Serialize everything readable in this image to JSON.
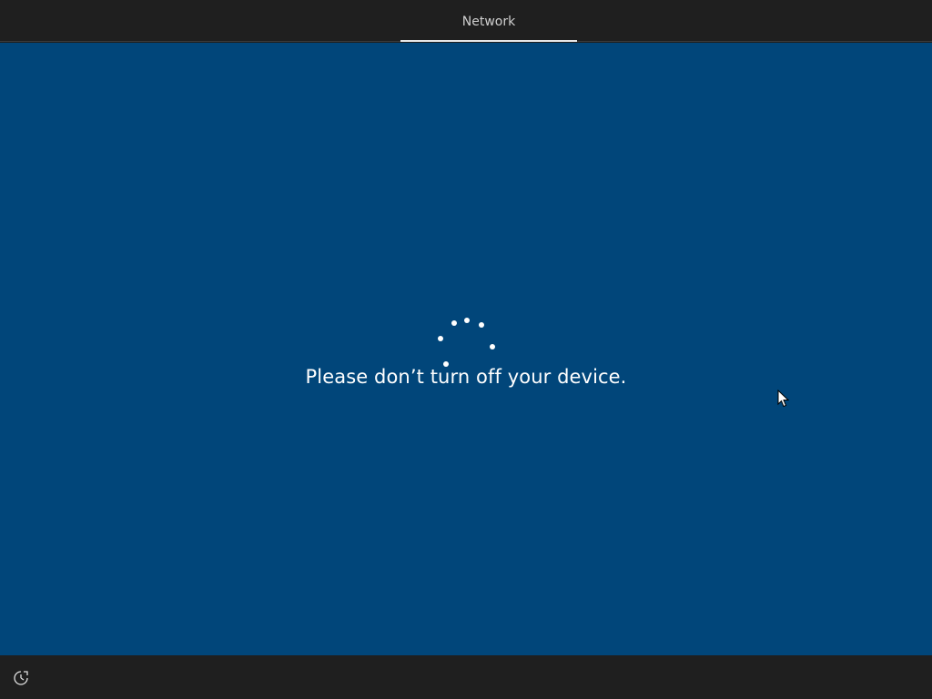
{
  "header": {
    "tab_label": "Network"
  },
  "main": {
    "message": "Please don’t turn off your device."
  },
  "footer": {
    "accessibility_icon": "ease-of-access-icon"
  },
  "colors": {
    "background": "#01467a",
    "bar": "#1f1f1f",
    "text": "#ffffff"
  }
}
